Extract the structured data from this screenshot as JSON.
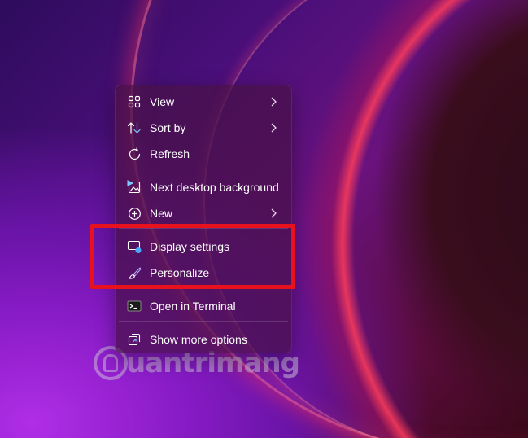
{
  "watermark": {
    "text": "uantrimang"
  },
  "context_menu": {
    "items": [
      {
        "label": "View",
        "icon": "grid-view-icon",
        "has_submenu": true
      },
      {
        "label": "Sort by",
        "icon": "sort-arrows-icon",
        "has_submenu": true
      },
      {
        "label": "Refresh",
        "icon": "refresh-icon",
        "has_submenu": false
      },
      {
        "label": "Next desktop background",
        "icon": "desktop-background-icon",
        "has_submenu": false
      },
      {
        "label": "New",
        "icon": "plus-circle-icon",
        "has_submenu": true
      },
      {
        "label": "Display settings",
        "icon": "display-settings-icon",
        "has_submenu": false
      },
      {
        "label": "Personalize",
        "icon": "paintbrush-icon",
        "has_submenu": false
      },
      {
        "label": "Open in Terminal",
        "icon": "terminal-icon",
        "has_submenu": false
      },
      {
        "label": "Show more options",
        "icon": "show-more-icon",
        "has_submenu": false
      }
    ]
  },
  "annotation": {
    "highlight_color": "#e8121e"
  }
}
